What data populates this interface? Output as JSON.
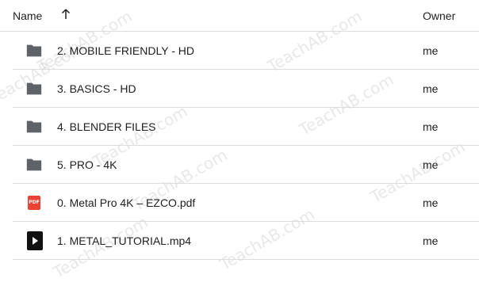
{
  "header": {
    "name_label": "Name",
    "owner_label": "Owner",
    "sort_direction": "arrow-up-icon"
  },
  "files": [
    {
      "name": "2. MOBILE FRIENDLY - HD",
      "owner": "me",
      "type": "folder",
      "icon": "folder-icon"
    },
    {
      "name": "3. BASICS - HD",
      "owner": "me",
      "type": "folder",
      "icon": "folder-icon"
    },
    {
      "name": "4. BLENDER FILES",
      "owner": "me",
      "type": "folder",
      "icon": "folder-icon"
    },
    {
      "name": "5. PRO - 4K",
      "owner": "me",
      "type": "folder",
      "icon": "folder-icon"
    },
    {
      "name": "0. Metal Pro 4K – EZCO.pdf",
      "owner": "me",
      "type": "pdf",
      "icon": "pdf-icon",
      "badge": "PDF"
    },
    {
      "name": "1. METAL_TUTORIAL.mp4",
      "owner": "me",
      "type": "video",
      "icon": "video-icon"
    }
  ],
  "watermark": "TeachAB.com",
  "colors": {
    "folder": "#5f6368",
    "pdf": "#ea4335",
    "video": "#111111",
    "divider": "#dadce0"
  }
}
